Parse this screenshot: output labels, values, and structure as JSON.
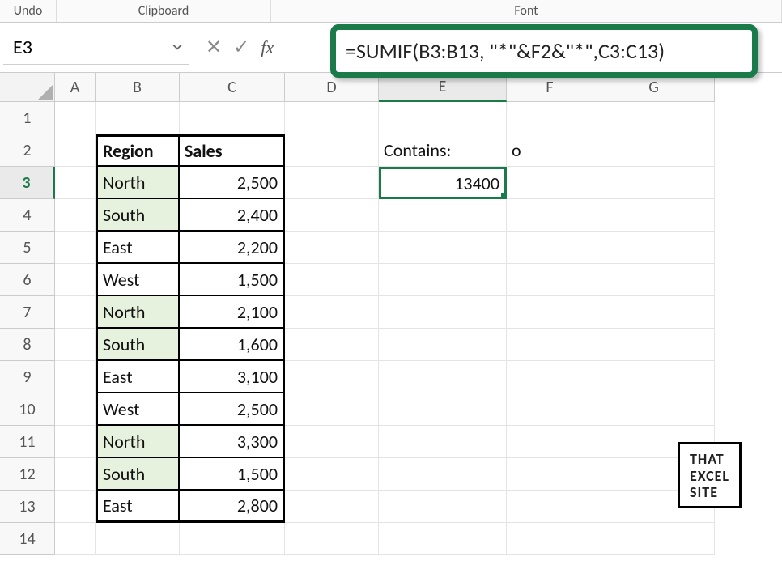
{
  "ribbon": {
    "undo": "Undo",
    "clipboard": "Clipboard",
    "font": "Font"
  },
  "nameBox": "E3",
  "fx": {
    "cancel": "✕",
    "enter": "✓",
    "label": "fx"
  },
  "formula": "=SUMIF(B3:B13, \"*\"&F2&\"*\",C3:C13)",
  "columns": [
    "A",
    "B",
    "C",
    "D",
    "E",
    "F",
    "G"
  ],
  "activeColumn": "E",
  "rows": [
    "1",
    "2",
    "3",
    "4",
    "5",
    "6",
    "7",
    "8",
    "9",
    "10",
    "11",
    "12",
    "13",
    "14"
  ],
  "activeRow": "3",
  "table": {
    "headers": {
      "region": "Region",
      "sales": "Sales"
    },
    "rows": [
      {
        "region": "North",
        "sales": "2,500",
        "hl": true
      },
      {
        "region": "South",
        "sales": "2,400",
        "hl": true
      },
      {
        "region": "East",
        "sales": "2,200",
        "hl": false
      },
      {
        "region": "West",
        "sales": "1,500",
        "hl": false
      },
      {
        "region": "North",
        "sales": "2,100",
        "hl": true
      },
      {
        "region": "South",
        "sales": "1,600",
        "hl": true
      },
      {
        "region": "East",
        "sales": "3,100",
        "hl": false
      },
      {
        "region": "West",
        "sales": "2,500",
        "hl": false
      },
      {
        "region": "North",
        "sales": "3,300",
        "hl": true
      },
      {
        "region": "South",
        "sales": "1,500",
        "hl": true
      },
      {
        "region": "East",
        "sales": "2,800",
        "hl": false
      }
    ]
  },
  "side": {
    "containsLabel": "Contains:",
    "containsValue": "o",
    "result": "13400"
  },
  "watermark": {
    "l1": "THAT",
    "l2": "EXCEL",
    "l3": "SITE"
  }
}
